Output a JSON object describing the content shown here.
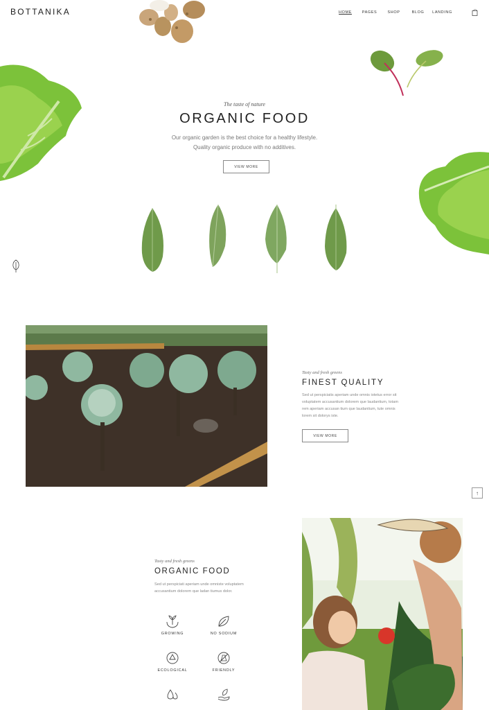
{
  "header": {
    "logo": "BOTTANIKA",
    "nav": [
      "HOME",
      "PAGES",
      "SHOP",
      "BLOG",
      "LANDING"
    ],
    "active_nav": "HOME",
    "cart_icon": "cart-icon"
  },
  "hero": {
    "tagline": "The taste of nature",
    "title": "ORGANIC FOOD",
    "text": "Our organic garden is the best choice for a healthy lifestyle. Quality organic produce with no additives.",
    "button": "VIEW MORE"
  },
  "section_quality": {
    "tagline": "Tasty and fresh greens",
    "title": "FINEST QUALITY",
    "text": "Sed ut perspiciatis aperiam unde omnis iotetus error sit voluptatem accusantium dolorem que laudantium, totam rem aperiam accusan tium que laudantium, tute omnis lorem sit dolorys iste.",
    "button": "VIEW MORE"
  },
  "scroll_top_icon": "arrow-up-icon",
  "section_organic": {
    "tagline": "Tasty and fresh greens",
    "title": "ORGANIC FOOD",
    "text": "Sed ut perspiciati aperiam unde omniste voluptatem accusantium dolorem que ladan tiumus dolor.",
    "features": [
      {
        "label": "GROWING",
        "icon": "hands-plant-icon"
      },
      {
        "label": "NO SODIUM",
        "icon": "leaf-icon"
      },
      {
        "label": "ECOLOGICAL",
        "icon": "recycle-icon"
      },
      {
        "label": "FRIENDLY",
        "icon": "no-chemicals-icon"
      },
      {
        "label": "",
        "icon": "drops-icon"
      },
      {
        "label": "",
        "icon": "hand-leaf-icon"
      }
    ]
  },
  "colors": {
    "leaf": "#6f9a4a",
    "lettuce": "#7fbf3a",
    "soil": "#4a3a2e",
    "text": "#222222",
    "muted": "#888888"
  }
}
